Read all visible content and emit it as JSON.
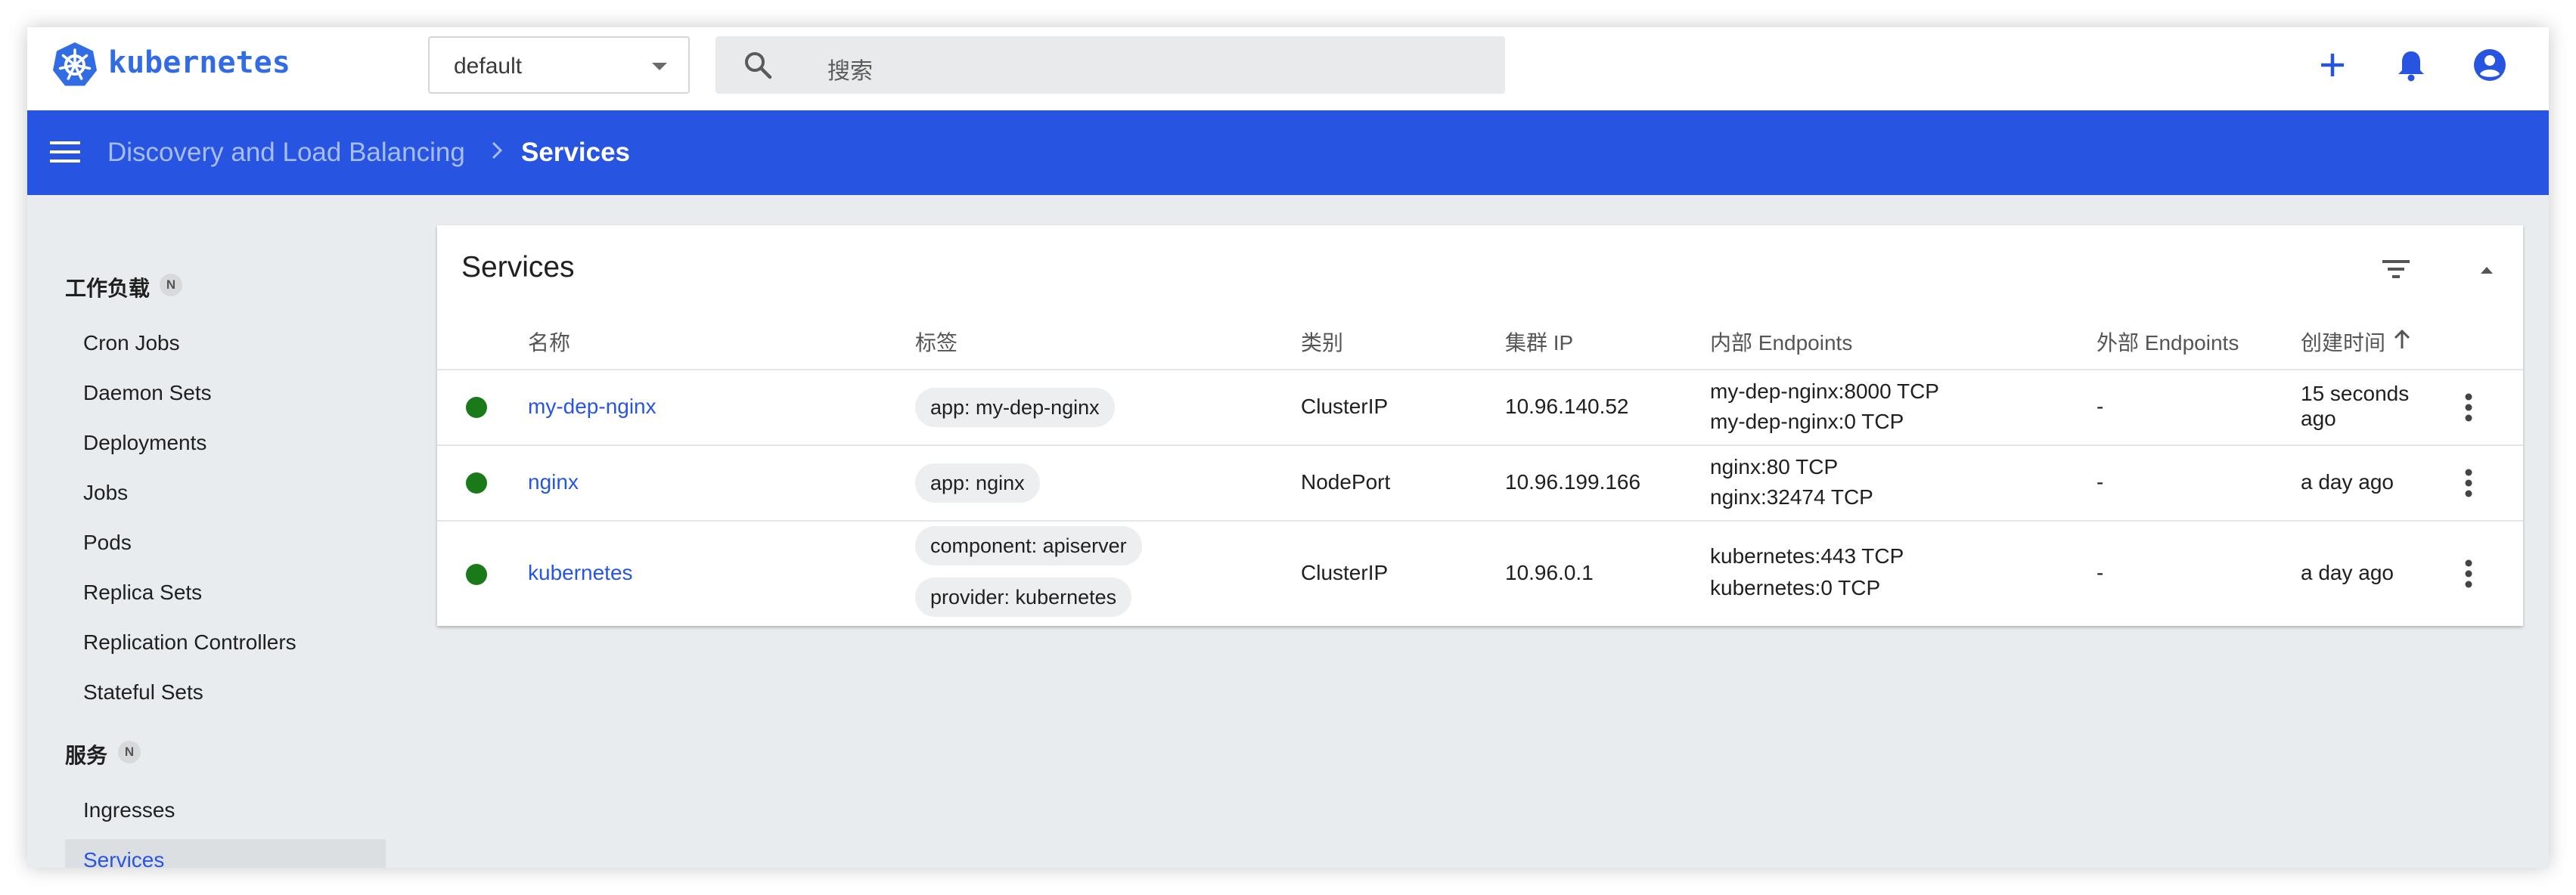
{
  "app": {
    "brand": "kubernetes",
    "namespace": "default",
    "search_placeholder": "搜索",
    "colors": {
      "accent": "#2755e2",
      "brand": "#326ce5",
      "status_ok": "#1a7a1a"
    }
  },
  "toolbar": {
    "icons": [
      "add-icon",
      "bell-icon",
      "account-icon"
    ]
  },
  "breadcrumb": {
    "parent": "Discovery and Load Balancing",
    "current": "Services"
  },
  "sidebar": {
    "sections": [
      {
        "title": "工作负载",
        "badge": "N",
        "items": [
          "Cron Jobs",
          "Daemon Sets",
          "Deployments",
          "Jobs",
          "Pods",
          "Replica Sets",
          "Replication Controllers",
          "Stateful Sets"
        ]
      },
      {
        "title": "服务",
        "badge": "N",
        "items": [
          "Ingresses",
          "Services"
        ]
      }
    ],
    "active_item": "Services"
  },
  "card": {
    "title": "Services",
    "columns": [
      "名称",
      "标签",
      "类别",
      "集群 IP",
      "内部 Endpoints",
      "外部 Endpoints",
      "创建时间"
    ],
    "sort_column": "创建时间",
    "rows": [
      {
        "name": "my-dep-nginx",
        "labels": [
          "app: my-dep-nginx"
        ],
        "type": "ClusterIP",
        "cluster_ip": "10.96.140.52",
        "internal_endpoints": [
          "my-dep-nginx:8000 TCP",
          "my-dep-nginx:0 TCP"
        ],
        "external_endpoints": "-",
        "created": [
          "15 seconds",
          "ago"
        ]
      },
      {
        "name": "nginx",
        "labels": [
          "app: nginx"
        ],
        "type": "NodePort",
        "cluster_ip": "10.96.199.166",
        "internal_endpoints": [
          "nginx:80 TCP",
          "nginx:32474 TCP"
        ],
        "external_endpoints": "-",
        "created": [
          "a day ago"
        ]
      },
      {
        "name": "kubernetes",
        "labels": [
          "component: apiserver",
          "provider: kubernetes"
        ],
        "type": "ClusterIP",
        "cluster_ip": "10.96.0.1",
        "internal_endpoints": [
          "kubernetes:443 TCP",
          "kubernetes:0 TCP"
        ],
        "external_endpoints": "-",
        "created": [
          "a day ago"
        ]
      }
    ]
  }
}
